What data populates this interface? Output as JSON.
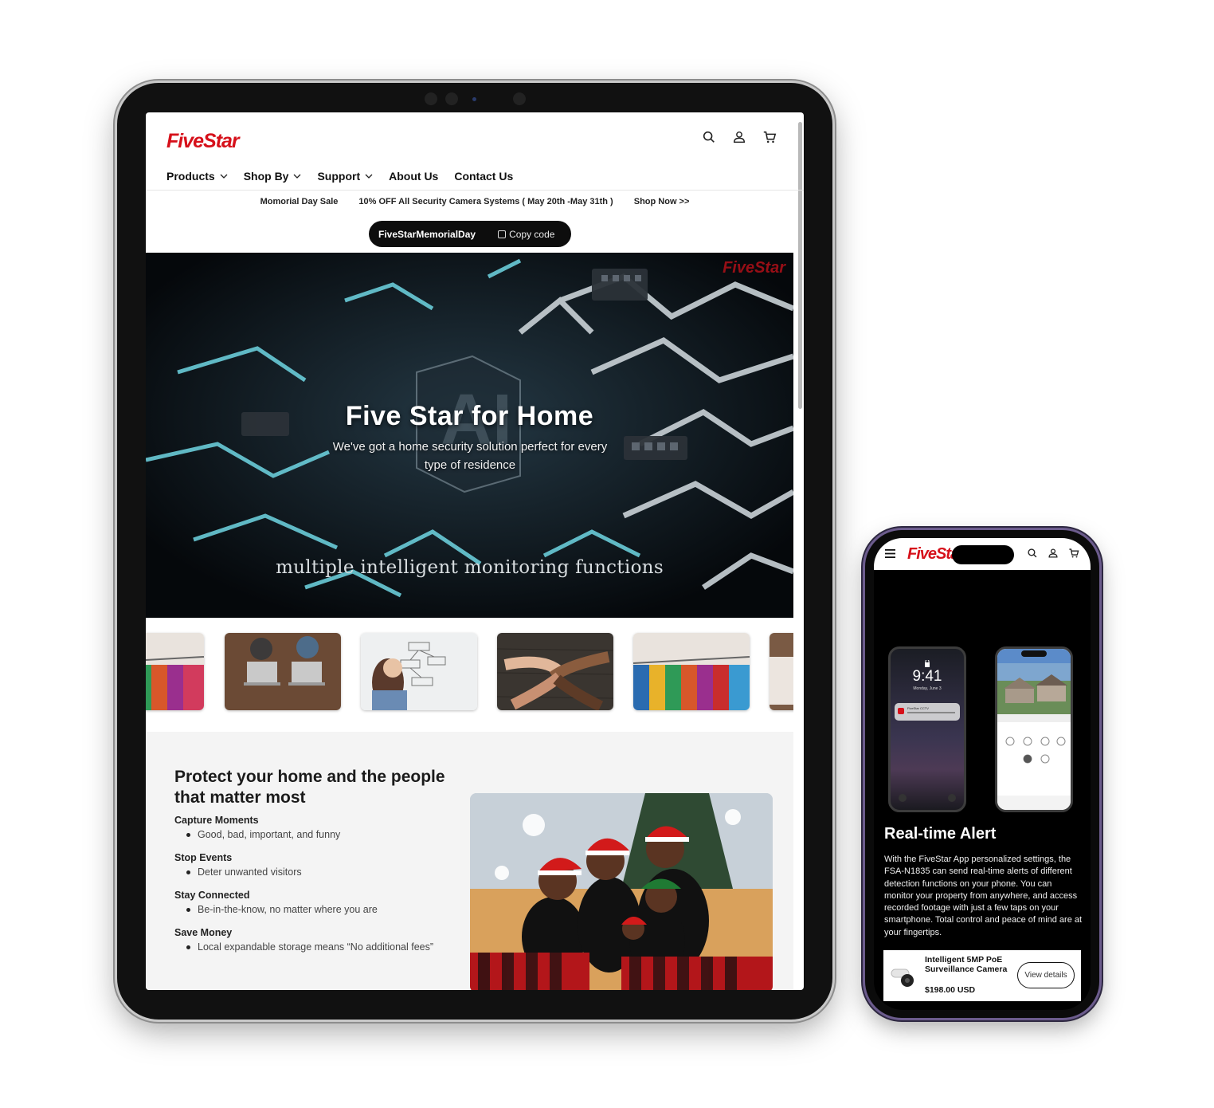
{
  "brand": {
    "name": "FiveStar",
    "color": "#d6101a"
  },
  "tablet": {
    "header_icons": [
      "search-icon",
      "user-icon",
      "cart-icon"
    ],
    "nav": [
      {
        "label": "Products",
        "has_dropdown": true
      },
      {
        "label": "Shop By",
        "has_dropdown": true
      },
      {
        "label": "Support",
        "has_dropdown": true
      },
      {
        "label": "About Us",
        "has_dropdown": false
      },
      {
        "label": "Contact Us",
        "has_dropdown": false
      }
    ],
    "promo": {
      "sale": "Momorial Day Sale",
      "offer": "10% OFF All Security Camera Systems ( May 20th -May 31th )",
      "cta": "Shop Now >>",
      "code": "FiveStarMemorialDay",
      "copy_label": "Copy code"
    },
    "hero": {
      "title": "Five Star for Home",
      "subtitle": "We've got a home security solution perfect for every type of residence",
      "caption": "multiple intelligent monitoring functions",
      "watermark": "FiveStar"
    },
    "thumbnails": [
      "clothes-rack",
      "laptops-on-desk",
      "whiteboard-planning",
      "hands-together",
      "clothes-rack",
      "partial-image"
    ],
    "feature": {
      "title": "Protect your home and the people that matter most",
      "groups": [
        {
          "heading": "Capture Moments",
          "bullet": "Good, bad, important, and funny"
        },
        {
          "heading": "Stop Events",
          "bullet": "Deter unwanted visitors"
        },
        {
          "heading": "Stay Connected",
          "bullet": "Be-in-the-know, no matter where you are"
        },
        {
          "heading": "Save Money",
          "bullet": "Local expandable storage means “No additional fees”"
        }
      ],
      "photo": "family-in-santa-hats"
    }
  },
  "phone": {
    "header_icons": [
      "menu-icon",
      "search-icon",
      "user-icon",
      "cart-icon"
    ],
    "lockscreen_time": "9:41",
    "lockscreen_date": "Monday, June 3",
    "notification_app": "FiveStar CCTV",
    "section_title": "Real-time Alert",
    "section_body": "With the FiveStar App personalized settings, the FSA-N1835 can send real-time alerts of different detection functions on your phone. You can monitor your property from anywhere, and access recorded footage with just a few taps on your smartphone. Total control and peace of mind are at your fingertips.",
    "product": {
      "name": "Intelligent 5MP PoE Surveillance Camera",
      "price": "$198.00 USD",
      "cta": "View details"
    }
  }
}
